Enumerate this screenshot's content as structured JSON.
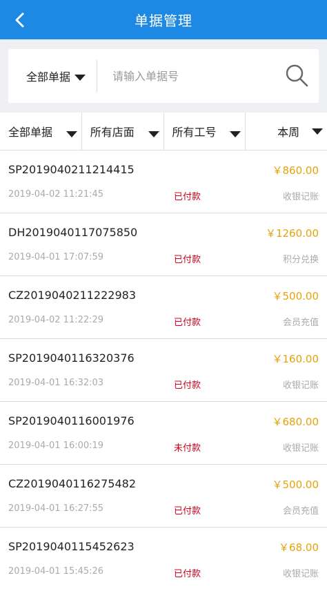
{
  "header": {
    "title": "单据管理"
  },
  "search": {
    "type_select": "全部单据",
    "placeholder": "请输入单据号"
  },
  "filters": [
    {
      "label": "全部单据"
    },
    {
      "label": "所有店面"
    },
    {
      "label": "所有工号"
    },
    {
      "label": "本周"
    }
  ],
  "colors": {
    "primary": "#1e88e5",
    "amount": "#e6a20a",
    "status": "#d0021b",
    "muted": "#aaaaaa"
  },
  "records": [
    {
      "no": "SP2019040211214415",
      "amount": "￥860.00",
      "time": "2019-04-02 11:21:45",
      "status": "已付款",
      "type": "收银记账"
    },
    {
      "no": "DH2019040117075850",
      "amount": "￥1260.00",
      "time": "2019-04-01 17:07:59",
      "status": "已付款",
      "type": "积分兑换"
    },
    {
      "no": "CZ2019040211222983",
      "amount": "￥500.00",
      "time": "2019-04-02 11:22:29",
      "status": "已付款",
      "type": "会员充值"
    },
    {
      "no": "SP2019040116320376",
      "amount": "￥160.00",
      "time": "2019-04-01 16:32:03",
      "status": "已付款",
      "type": "收银记账"
    },
    {
      "no": "SP2019040116001976",
      "amount": "￥680.00",
      "time": "2019-04-01 16:00:19",
      "status": "未付款",
      "type": "收银记账"
    },
    {
      "no": "CZ2019040116275482",
      "amount": "￥500.00",
      "time": "2019-04-01 16:27:55",
      "status": "已付款",
      "type": "会员充值"
    },
    {
      "no": "SP2019040115452623",
      "amount": "￥68.00",
      "time": "2019-04-01 15:45:26",
      "status": "已付款",
      "type": "收银记账"
    }
  ]
}
